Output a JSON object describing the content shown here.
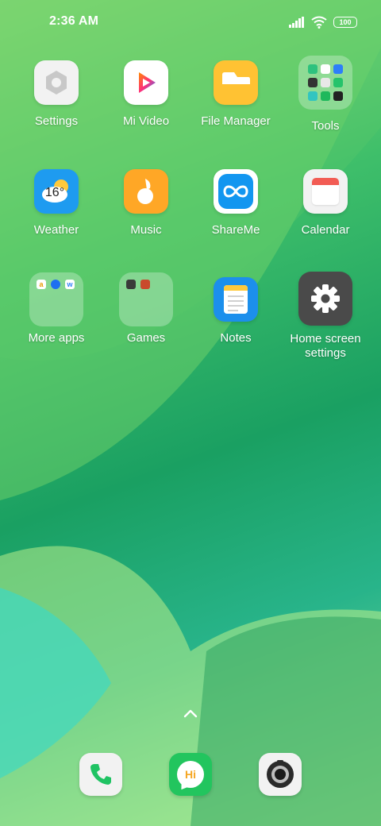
{
  "status_bar": {
    "time": "2:36 AM",
    "battery": "100",
    "icons": [
      "signal-icon",
      "wifi-icon",
      "battery-icon"
    ]
  },
  "apps": [
    {
      "label": "Settings",
      "icon": "settings-icon"
    },
    {
      "label": "Mi Video",
      "icon": "mi-video-icon"
    },
    {
      "label": "File Manager",
      "icon": "file-manager-icon"
    },
    {
      "label": "Tools",
      "icon": "tools-folder"
    },
    {
      "label": "Weather",
      "icon": "weather-icon",
      "badge": "16°"
    },
    {
      "label": "Music",
      "icon": "music-icon"
    },
    {
      "label": "ShareMe",
      "icon": "shareme-icon"
    },
    {
      "label": "Calendar",
      "icon": "calendar-icon"
    },
    {
      "label": "More apps",
      "icon": "more-apps-folder"
    },
    {
      "label": "Games",
      "icon": "games-folder"
    },
    {
      "label": "Notes",
      "icon": "notes-icon"
    },
    {
      "label": "Home screen settings",
      "icon": "home-screen-settings-icon"
    }
  ],
  "dock": {
    "items": [
      {
        "icon": "phone-icon"
      },
      {
        "icon": "messaging-icon",
        "text": "Hi"
      },
      {
        "icon": "camera-icon"
      }
    ]
  },
  "colors": {
    "settings_bg": "#f2f2f2",
    "file_manager": "#ffc233",
    "weather": "#1e9bf0",
    "music": "#ffa726",
    "shareme": "#1296f0",
    "calendar_red": "#f25c54",
    "notes_blue": "#1c8fec",
    "notes_yellow": "#ffc93c",
    "home_settings_bg": "#4a4a4a",
    "phone_green": "#1fc363",
    "messaging_green": "#22c55e"
  }
}
